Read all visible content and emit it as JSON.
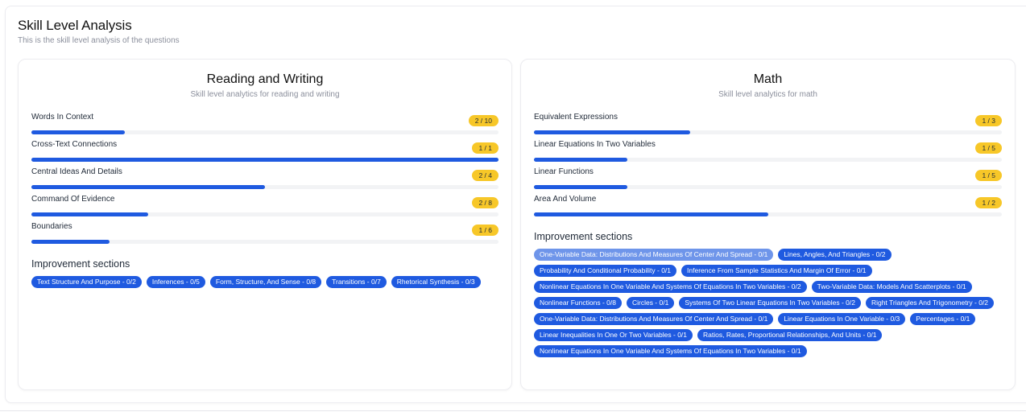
{
  "header": {
    "title": "Skill Level Analysis",
    "subtitle": "This is the skill level analysis of the questions"
  },
  "reading_writing": {
    "title": "Reading and Writing",
    "subtitle": "Skill level analytics for reading and writing",
    "skills": [
      {
        "name": "Words In Context",
        "badge": "2 / 10",
        "progress": 0.2
      },
      {
        "name": "Cross-Text Connections",
        "badge": "1 / 1",
        "progress": 1.0
      },
      {
        "name": "Central Ideas And Details",
        "badge": "2 / 4",
        "progress": 0.5
      },
      {
        "name": "Command Of Evidence",
        "badge": "2 / 8",
        "progress": 0.25
      },
      {
        "name": "Boundaries",
        "badge": "1 / 6",
        "progress": 0.1667
      }
    ],
    "improvement_title": "Improvement sections",
    "tags": [
      "Text Structure And Purpose - 0/2",
      "Inferences - 0/5",
      "Form, Structure, And Sense - 0/8",
      "Transitions - 0/7",
      "Rhetorical Synthesis - 0/3"
    ]
  },
  "math": {
    "title": "Math",
    "subtitle": "Skill level analytics for math",
    "skills": [
      {
        "name": "Equivalent Expressions",
        "badge": "1 / 3",
        "progress": 0.3333
      },
      {
        "name": "Linear Equations In Two Variables",
        "badge": "1 / 5",
        "progress": 0.2
      },
      {
        "name": "Linear Functions",
        "badge": "1 / 5",
        "progress": 0.2
      },
      {
        "name": "Area And Volume",
        "badge": "1 / 2",
        "progress": 0.5
      }
    ],
    "improvement_title": "Improvement sections",
    "tags": [
      "One-Variable Data: Distributions And Measures Of Center And Spread - 0/1",
      "Lines, Angles, And Triangles - 0/2",
      "Probability And Conditional Probability - 0/1",
      "Inference From Sample Statistics And Margin Of Error - 0/1",
      "Nonlinear Equations In One Variable And Systems Of Equations In Two Variables - 0/2",
      "Two-Variable Data: Models And Scatterplots - 0/1",
      "Nonlinear Functions - 0/8",
      "Circles - 0/1",
      "Systems Of Two Linear Equations In Two Variables - 0/2",
      "Right Triangles And Trigonometry - 0/2",
      "One-Variable Data: Distributions And Measures Of Center And Spread - 0/1",
      "Linear Equations In One Variable - 0/3",
      "Percentages - 0/1",
      "Linear Inequalities In One Or Two Variables - 0/1",
      "Ratios, Rates, Proportional Relationships, And Units - 0/1",
      "Nonlinear Equations In One Variable And Systems Of Equations In Two Variables - 0/1"
    ]
  },
  "colors": {
    "accent": "#1f5ae0",
    "accent_light": "#6e95ea",
    "badge": "#f7c728"
  }
}
